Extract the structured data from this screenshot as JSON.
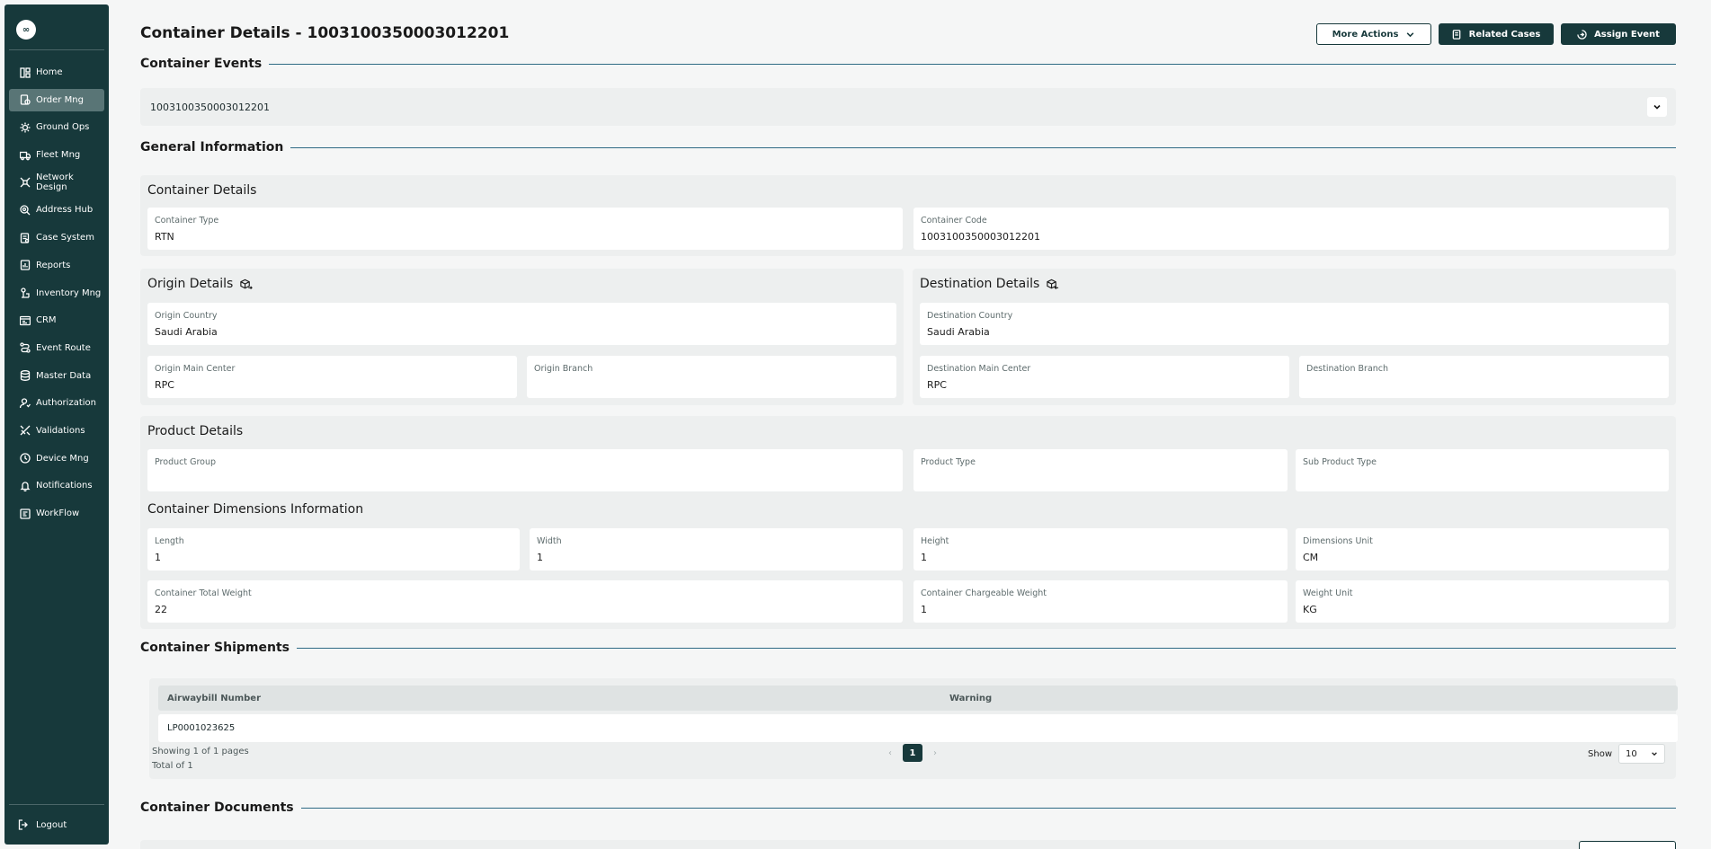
{
  "sidebar": {
    "logo": "∞",
    "items": [
      {
        "label": "Home",
        "icon": "home-icon",
        "active": false
      },
      {
        "label": "Order Mng",
        "icon": "order-icon",
        "active": true
      },
      {
        "label": "Ground Ops",
        "icon": "ground-ops-icon",
        "active": false
      },
      {
        "label": "Fleet Mng",
        "icon": "truck-icon",
        "active": false
      },
      {
        "label": "Network Design",
        "icon": "network-icon",
        "active": false
      },
      {
        "label": "Address Hub",
        "icon": "address-icon",
        "active": false
      },
      {
        "label": "Case System",
        "icon": "case-icon",
        "active": false
      },
      {
        "label": "Reports",
        "icon": "reports-icon",
        "active": false
      },
      {
        "label": "Inventory Mng",
        "icon": "inventory-icon",
        "active": false
      },
      {
        "label": "CRM",
        "icon": "crm-icon",
        "active": false
      },
      {
        "label": "Event Route",
        "icon": "route-icon",
        "active": false
      },
      {
        "label": "Master Data",
        "icon": "database-icon",
        "active": false
      },
      {
        "label": "Authorization",
        "icon": "user-icon",
        "active": false
      },
      {
        "label": "Validations",
        "icon": "validation-icon",
        "active": false
      },
      {
        "label": "Device Mng",
        "icon": "device-icon",
        "active": false
      },
      {
        "label": "Notifications",
        "icon": "bell-icon",
        "active": false
      },
      {
        "label": "WorkFlow",
        "icon": "workflow-icon",
        "active": false
      }
    ],
    "logout": "Logout"
  },
  "header": {
    "title": "Container Details - 1003100350003012201",
    "more_actions": "More Actions",
    "related_cases": "Related Cases",
    "assign_event": "Assign Event"
  },
  "events": {
    "heading": "Container Events",
    "selected": "1003100350003012201"
  },
  "general": {
    "heading": "General Information",
    "container_details": {
      "title": "Container Details",
      "type_label": "Container Type",
      "type_value": "RTN",
      "code_label": "Container Code",
      "code_value": "1003100350003012201"
    },
    "origin": {
      "title": "Origin Details",
      "country_label": "Origin Country",
      "country_value": "Saudi Arabia",
      "center_label": "Origin Main Center",
      "center_value": "RPC",
      "branch_label": "Origin Branch",
      "branch_value": ""
    },
    "destination": {
      "title": "Destination Details",
      "country_label": "Destination Country",
      "country_value": "Saudi Arabia",
      "center_label": "Destination Main Center",
      "center_value": "RPC",
      "branch_label": "Destination Branch",
      "branch_value": ""
    },
    "product": {
      "title": "Product Details",
      "group_label": "Product Group",
      "group_value": "",
      "type_label": "Product Type",
      "type_value": "",
      "sub_label": "Sub Product Type",
      "sub_value": ""
    },
    "dimensions": {
      "title": "Container Dimensions Information",
      "length_label": "Length",
      "length_value": "1",
      "width_label": "Width",
      "width_value": "1",
      "height_label": "Height",
      "height_value": "1",
      "unit_label": "Dimensions Unit",
      "unit_value": "CM",
      "total_weight_label": "Container Total Weight",
      "total_weight_value": "22",
      "chargeable_label": "Container Chargeable Weight",
      "chargeable_value": "1",
      "weight_unit_label": "Weight Unit",
      "weight_unit_value": "KG"
    }
  },
  "shipments": {
    "heading": "Container Shipments",
    "columns": [
      "Airwaybill Number",
      "Warning"
    ],
    "rows": [
      {
        "awb": "LP0001023625",
        "warning": ""
      }
    ],
    "showing": "Showing 1 of 1 pages",
    "total": "Total of 1",
    "page": "1",
    "show_label": "Show",
    "page_size": "10"
  },
  "documents": {
    "heading": "Container Documents"
  },
  "colors": {
    "sidebar_bg": "#17393b",
    "active_item": "#597576",
    "section_line": "#2e6a84",
    "panel_bg": "#edefef"
  }
}
